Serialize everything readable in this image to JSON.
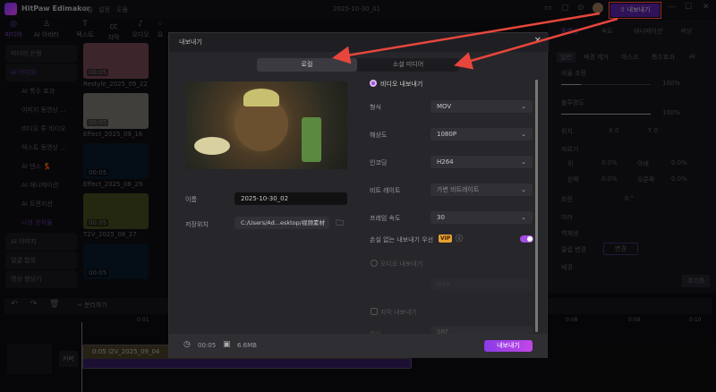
{
  "app": {
    "name": "HitPaw Edimakor",
    "menu": [
      "파일",
      "설정",
      "도움"
    ],
    "project_title": "2025-10-30_01",
    "export_button": "내보내기"
  },
  "toolbar": [
    {
      "label": "미디어",
      "icon": "media-icon"
    },
    {
      "label": "AI 아바타",
      "icon": "avatar-icon"
    },
    {
      "label": "텍스트",
      "icon": "text-icon"
    },
    {
      "label": "자막",
      "icon": "caption-icon"
    },
    {
      "label": "오디오",
      "icon": "audio-icon"
    },
    {
      "label": "요",
      "icon": "effects-icon"
    }
  ],
  "sidebar": {
    "items": [
      {
        "label": "미디어 은행",
        "type": "box"
      },
      {
        "label": "AI 비디오",
        "type": "active"
      },
      {
        "label": "AI 특수 효과",
        "type": "sub"
      },
      {
        "label": "이미지 동영상 ...",
        "type": "sub"
      },
      {
        "label": "비디오 투 비디오",
        "type": "sub"
      },
      {
        "label": "텍스트 동영상 ...",
        "type": "sub"
      },
      {
        "label": "AI 댄스 💃",
        "type": "sub"
      },
      {
        "label": "AI 애니메이션",
        "type": "sub"
      },
      {
        "label": "AI 트랜지션",
        "type": "sub"
      },
      {
        "label": "나의 창작물",
        "type": "subactive"
      },
      {
        "label": "AI 이미지",
        "type": "box"
      },
      {
        "label": "얼굴 합성",
        "type": "box"
      },
      {
        "label": "영상 향상기",
        "type": "box"
      }
    ]
  },
  "media": [
    {
      "name": "Restyle_2025_09_22",
      "duration": "00:05",
      "color": "#a86a7a"
    },
    {
      "name": "Effect_2025_09_16",
      "duration": "00:05",
      "color": "#b8b0a8"
    },
    {
      "name": "Effect_2025_08_29",
      "duration": "00:05",
      "color": "#0f2440"
    },
    {
      "name": "T2V_2025_08_27",
      "duration": "00:05",
      "color": "#6a7030"
    },
    {
      "name": "",
      "duration": "00:05",
      "color": "#0f2440"
    }
  ],
  "right_panel": {
    "tabs": [
      "동영상",
      "속도",
      "애니메이션",
      "색상"
    ],
    "subtabs": [
      "일반",
      "배경 제거",
      "마스크",
      "특수효과",
      "AI"
    ],
    "scale_label": "비율 조정",
    "scale_value": "100%",
    "opacity_label": "불투명도",
    "opacity_value": "100%",
    "position_label": "위치",
    "x": "0",
    "y": "0",
    "crop_label": "자르기",
    "crop": [
      {
        "label": "위",
        "value": "0.0%"
      },
      {
        "label": "아래",
        "value": "0.0%"
      },
      {
        "label": "왼쪽",
        "value": "0.0%"
      },
      {
        "label": "오른쪽",
        "value": "0.0%"
      }
    ],
    "rotate_label": "회전",
    "rotate_value": "0 °",
    "mirror_label": "미러",
    "reverse_label": "역재생",
    "replace_label": "클립 변경",
    "replace_button": "변경",
    "background_label": "배경",
    "reset_button": "초기화"
  },
  "timeline": {
    "split_label": "분리하기",
    "ticks": [
      "0:01",
      "0:08",
      "0:09",
      "0:10"
    ],
    "cover_label": "커버",
    "clip_label": "0:05 I2V_2025_09_04"
  },
  "dialog": {
    "title": "내보내기",
    "tabs": [
      "로컬",
      "소셜 미디어"
    ],
    "active_tab": 0,
    "name_label": "이름",
    "name_value": "2025-10-30_02",
    "location_label": "저장위치",
    "location_value": "C:/Users/Ad...esktop/视频素材",
    "video_export_label": "비디오 내보내기",
    "settings": [
      {
        "label": "형식",
        "value": "MOV"
      },
      {
        "label": "해상도",
        "value": "1080P"
      },
      {
        "label": "인코딩",
        "value": "H264"
      },
      {
        "label": "비트 레이트",
        "value": "가변 비트레이트"
      },
      {
        "label": "프레임 속도",
        "value": "30"
      }
    ],
    "lossless_label": "손실 없는 내보내기 우선",
    "vip_badge": "VIP",
    "lossless_on": true,
    "audio_export_label": "오디오 내보내기",
    "audio_format": "M4A",
    "subtitle_export_label": "자막 내보내기",
    "subtitle_format_label": "형식",
    "subtitle_format": "SRT",
    "duration": "00:05",
    "size": "6.6MB",
    "export_button": "내보내기"
  },
  "colors": {
    "accent": "#a14ee0",
    "annotation": "#e8463c"
  }
}
